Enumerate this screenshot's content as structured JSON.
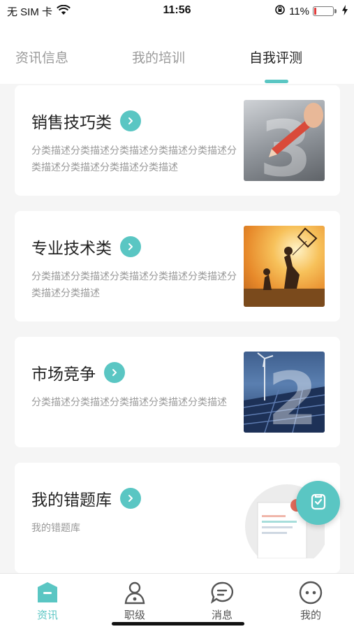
{
  "status_bar": {
    "carrier": "无 SIM 卡",
    "time": "11:56",
    "battery_percent": "11%",
    "battery_level": 0.11
  },
  "tabs": [
    {
      "label": "资讯信息",
      "active": false
    },
    {
      "label": "我的培训",
      "active": false
    },
    {
      "label": "自我评测",
      "active": true
    }
  ],
  "cards": [
    {
      "title": "销售技巧类",
      "desc": "分类描述分类描述分类描述分类描述分类描述分类描述分类描述分类描述分类描述"
    },
    {
      "title": "专业技术类",
      "desc": "分类描述分类描述分类描述分类描述分类描述分类描述分类描述"
    },
    {
      "title": "市场竞争",
      "desc": "分类描述分类描述分类描述分类描述分类描述"
    },
    {
      "title": "我的错题库",
      "desc": "我的错题库"
    }
  ],
  "bottom_nav": [
    {
      "label": "资讯",
      "icon": "news-icon",
      "active": true
    },
    {
      "label": "职级",
      "icon": "rank-icon",
      "active": false
    },
    {
      "label": "消息",
      "icon": "message-icon",
      "active": false
    },
    {
      "label": "我的",
      "icon": "profile-icon",
      "active": false
    }
  ],
  "colors": {
    "accent": "#5ac6c3",
    "battery_low": "#e23b3b"
  }
}
